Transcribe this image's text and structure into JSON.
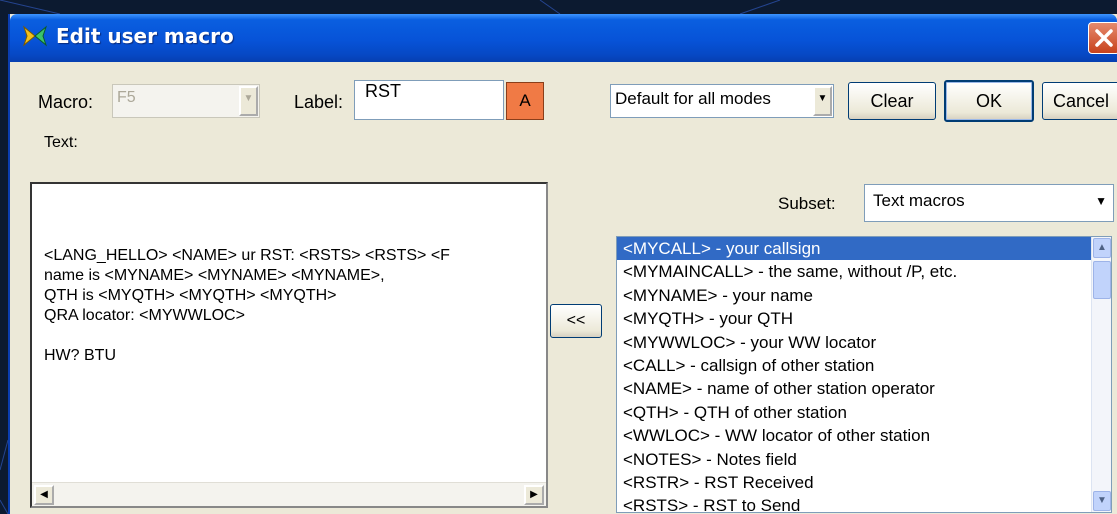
{
  "window": {
    "title": "Edit user macro"
  },
  "macro": {
    "label": "Macro:",
    "value": "F5"
  },
  "label_field": {
    "label": "Label:",
    "value": "RST",
    "color_button": "A"
  },
  "mode_select": {
    "value": "Default for all modes"
  },
  "buttons": {
    "clear": "Clear",
    "ok": "OK",
    "cancel": "Cancel",
    "insert": "<<"
  },
  "text": {
    "label": "Text:",
    "content": "<LANG_HELLO> <NAME> ur RST: <RSTS> <RSTS> <F\nname is <MYNAME> <MYNAME> <MYNAME>,\nQTH is <MYQTH> <MYQTH> <MYQTH>\nQRA locator: <MYWWLOC>\n\nHW? BTU"
  },
  "subset": {
    "label": "Subset:",
    "value": "Text macros"
  },
  "macro_list": [
    "<MYCALL> - your callsign",
    "<MYMAINCALL> - the same, without /P, etc.",
    "<MYNAME> - your name",
    "<MYQTH> - your QTH",
    "<MYWWLOC> - your WW locator",
    "<CALL> - callsign of other station",
    "<NAME> - name of other station operator",
    "<QTH> - QTH of other station",
    "<WWLOC> - WW locator of other station",
    "<NOTES> - Notes field",
    "<RSTR> - RST Received",
    "<RSTS> - RST to Send"
  ],
  "colors": {
    "titlebar": "#0753d8",
    "selection": "#316ac5",
    "color_button": "#f07a45",
    "dialog": "#ece9d8"
  }
}
